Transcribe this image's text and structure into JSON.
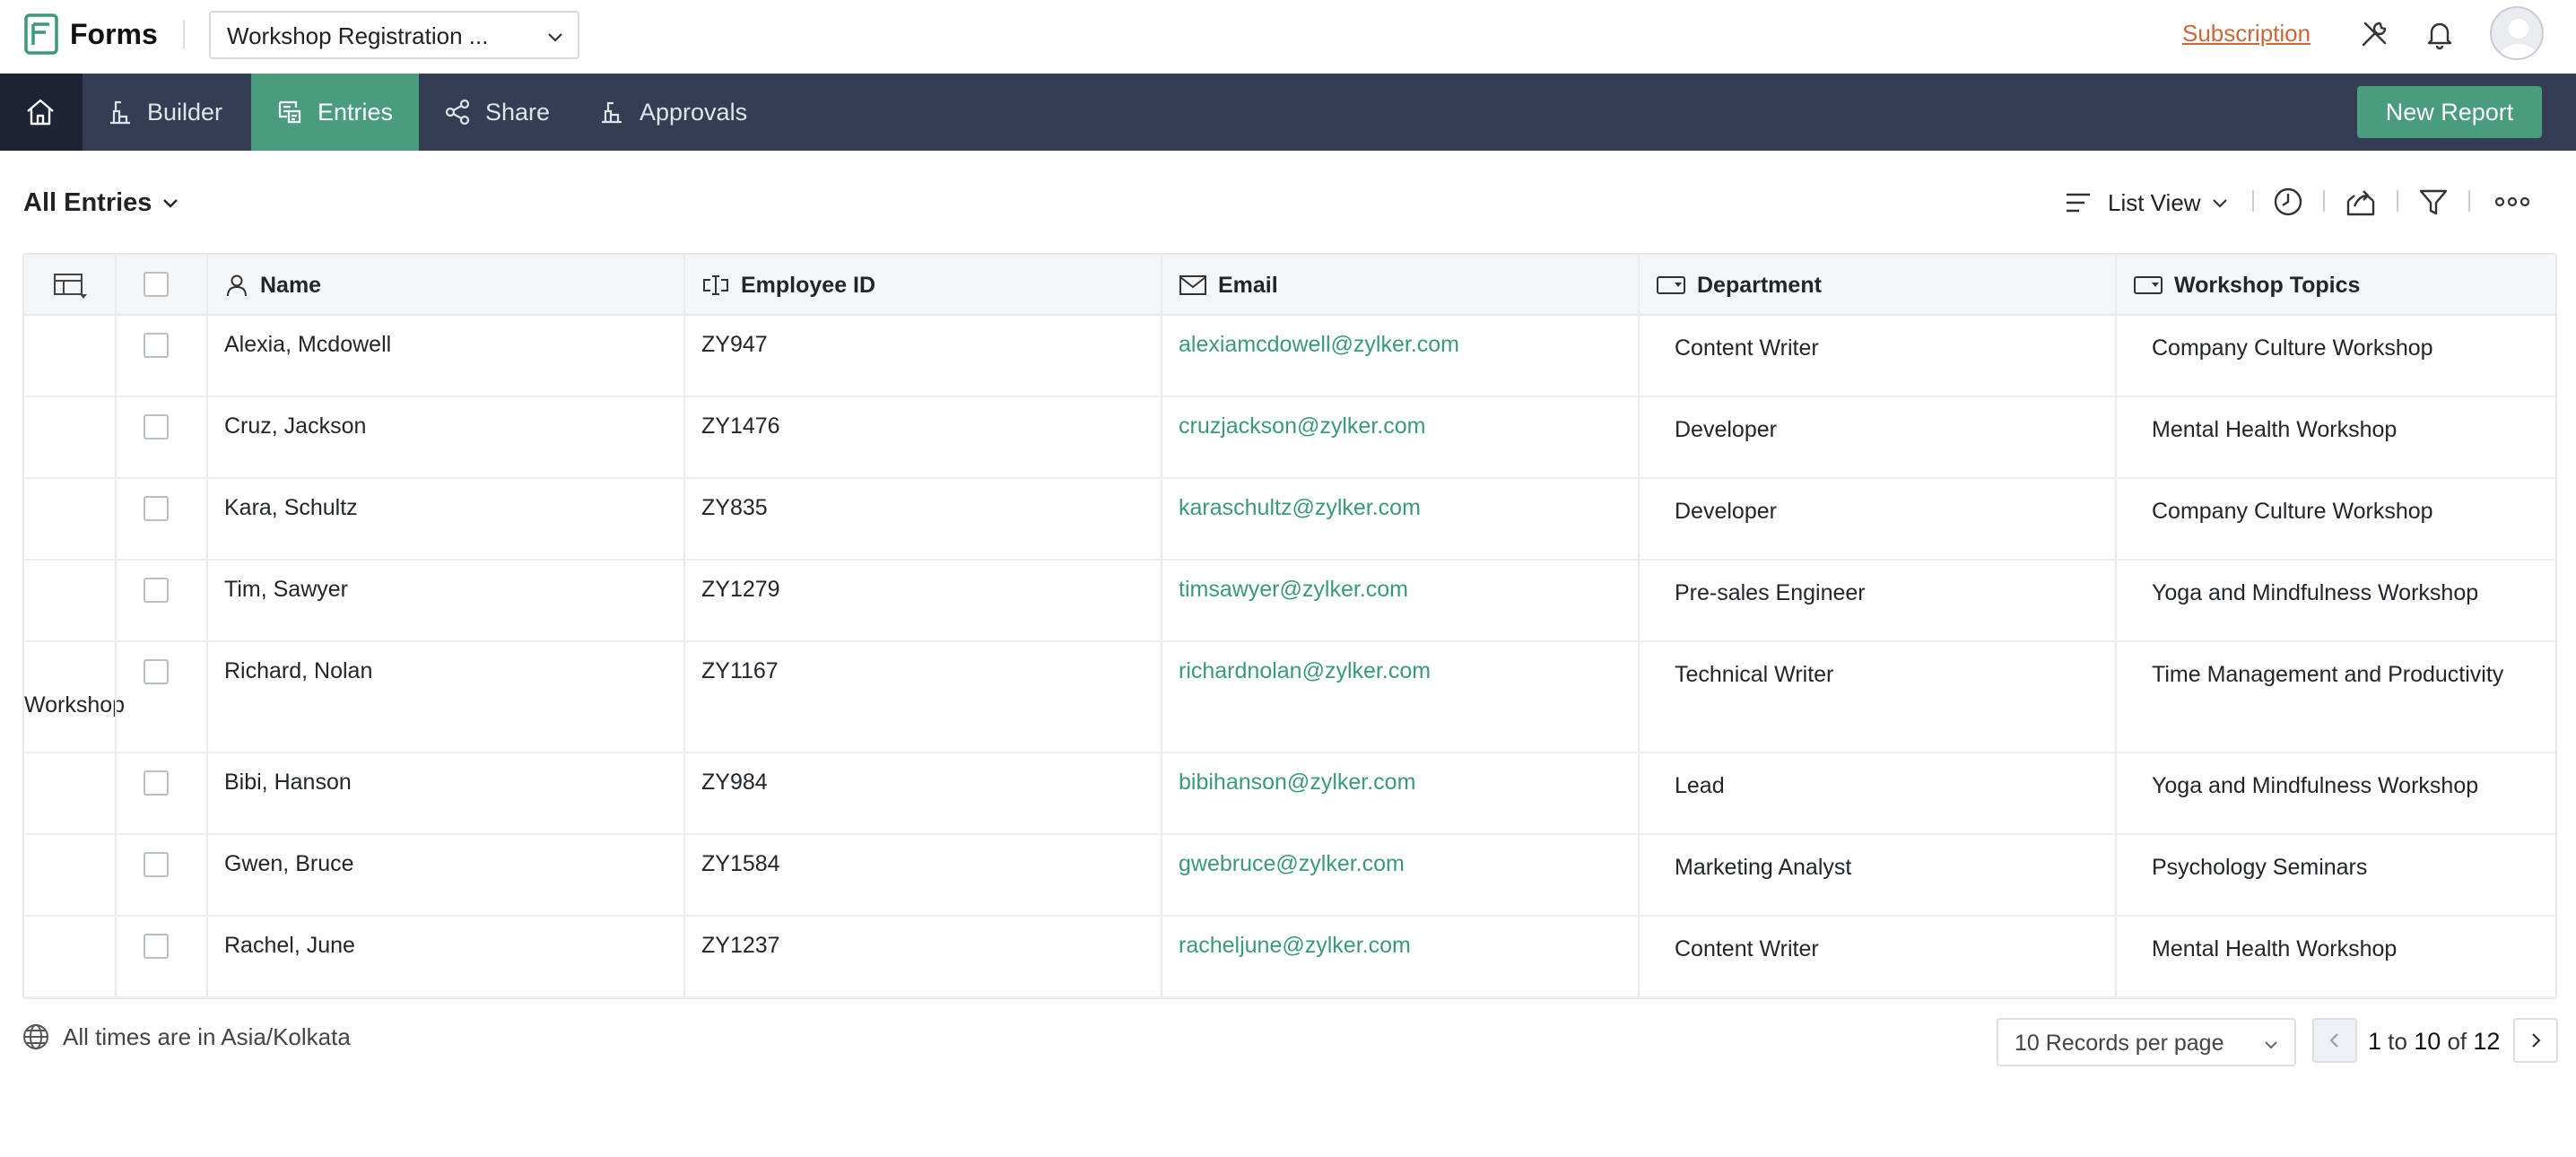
{
  "app": {
    "name": "Forms",
    "form_name": "Workshop Registration ...",
    "subscription_label": "Subscription"
  },
  "nav": {
    "items": [
      {
        "label": "Builder"
      },
      {
        "label": "Entries"
      },
      {
        "label": "Share"
      },
      {
        "label": "Approvals"
      }
    ],
    "active": "Entries",
    "new_report_label": "New Report"
  },
  "view": {
    "title": "All Entries",
    "mode_label": "List View"
  },
  "table": {
    "columns": [
      "Name",
      "Employee ID",
      "Email",
      "Department",
      "Workshop Topics"
    ],
    "rows": [
      {
        "name": "Alexia, Mcdowell",
        "employee_id": "ZY947",
        "email": "alexiamcdowell@zylker.com",
        "department": "Content Writer",
        "topic": "Company Culture Workshop"
      },
      {
        "name": "Cruz, Jackson",
        "employee_id": "ZY1476",
        "email": "cruzjackson@zylker.com",
        "department": "Developer",
        "topic": "Mental Health Workshop"
      },
      {
        "name": "Kara, Schultz",
        "employee_id": "ZY835",
        "email": "karaschultz@zylker.com",
        "department": "Developer",
        "topic": "Company Culture Workshop"
      },
      {
        "name": "Tim, Sawyer",
        "employee_id": "ZY1279",
        "email": "timsawyer@zylker.com",
        "department": "Pre-sales Engineer",
        "topic": "Yoga and Mindfulness Workshop"
      },
      {
        "name": "Richard, Nolan",
        "employee_id": "ZY1167",
        "email": "richardnolan@zylker.com",
        "department": "Technical Writer",
        "topic": "Time Management and Productivity",
        "topic_line2": "Workshop"
      },
      {
        "name": "Bibi, Hanson",
        "employee_id": "ZY984",
        "email": "bibihanson@zylker.com",
        "department": "Lead",
        "topic": "Yoga and Mindfulness Workshop"
      },
      {
        "name": "Gwen, Bruce",
        "employee_id": "ZY1584",
        "email": "gwebruce@zylker.com",
        "department": "Marketing Analyst",
        "topic": "Psychology Seminars"
      },
      {
        "name": "Rachel, June",
        "employee_id": "ZY1237",
        "email": "racheljune@zylker.com",
        "department": "Content Writer",
        "topic": "Mental Health Workshop"
      }
    ]
  },
  "footer": {
    "timezone_note": "All times are in Asia/Kolkata",
    "records_per_page": "10 Records per page",
    "page_from": "1",
    "page_to_label": "to",
    "page_to": "10",
    "page_of_label": "of",
    "page_total": "12"
  },
  "colors": {
    "accent": "#4a9c7f",
    "nav_bg": "#343d54",
    "subscription": "#c8693a",
    "email_link": "#3a9a76"
  },
  "icons": [
    "forms-logo-icon",
    "chevron-down-icon",
    "tools-icon",
    "bell-icon",
    "avatar",
    "home-icon",
    "builder-icon",
    "entries-icon",
    "share-icon",
    "approvals-icon",
    "list-view-icon",
    "clock-icon",
    "export-icon",
    "filter-icon",
    "more-icon",
    "column-settings-icon",
    "person-icon",
    "id-icon",
    "mail-icon",
    "dropdown-field-icon",
    "globe-icon",
    "chevron-left-icon",
    "chevron-right-icon"
  ]
}
